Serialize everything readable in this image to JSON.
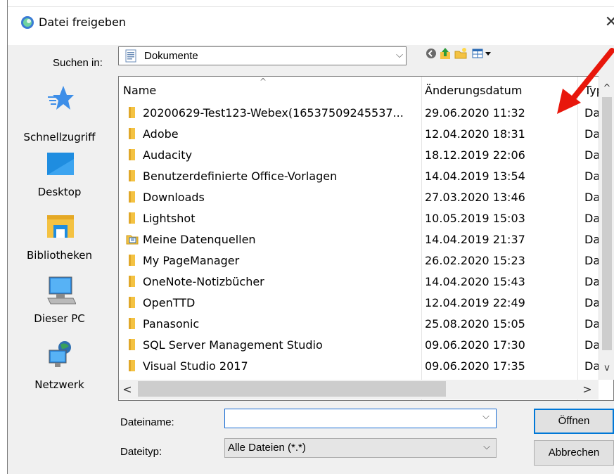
{
  "window": {
    "title": "Datei freigeben",
    "close_glyph": "✕"
  },
  "lookin": {
    "label": "Suchen in:",
    "value": "Dokumente",
    "chevron": "⌵"
  },
  "toolbar": {
    "icons": [
      "back-icon",
      "up-folder-icon",
      "new-folder-icon",
      "view-menu-icon"
    ]
  },
  "places": [
    {
      "label": "Schnellzugriff",
      "icon": "star-icon"
    },
    {
      "label": "Desktop",
      "icon": "desktop-icon"
    },
    {
      "label": "Bibliotheken",
      "icon": "libraries-icon"
    },
    {
      "label": "Dieser PC",
      "icon": "computer-icon"
    },
    {
      "label": "Netzwerk",
      "icon": "network-icon"
    }
  ],
  "columns": {
    "name": "Name",
    "date": "Änderungsdatum",
    "type": "Typ",
    "sort_glyph": "^"
  },
  "files": [
    {
      "name": "20200629-Test123-Webex(16537509245537...",
      "date": "29.06.2020 11:32",
      "type": "Dat",
      "icon": "folder-icon"
    },
    {
      "name": "Adobe",
      "date": "12.04.2020 18:31",
      "type": "Dat",
      "icon": "folder-icon"
    },
    {
      "name": "Audacity",
      "date": "18.12.2019 22:06",
      "type": "Dat",
      "icon": "folder-icon"
    },
    {
      "name": "Benutzerdefinierte Office-Vorlagen",
      "date": "14.04.2019 13:54",
      "type": "Dat",
      "icon": "folder-icon"
    },
    {
      "name": "Downloads",
      "date": "27.03.2020 13:46",
      "type": "Dat",
      "icon": "folder-icon"
    },
    {
      "name": "Lightshot",
      "date": "10.05.2019 15:03",
      "type": "Dat",
      "icon": "folder-icon"
    },
    {
      "name": "Meine Datenquellen",
      "date": "14.04.2019 21:37",
      "type": "Dat",
      "icon": "data-sources-folder-icon"
    },
    {
      "name": "My PageManager",
      "date": "26.02.2020 15:23",
      "type": "Dat",
      "icon": "folder-icon"
    },
    {
      "name": "OneNote-Notizbücher",
      "date": "14.04.2020 15:43",
      "type": "Dat",
      "icon": "folder-icon"
    },
    {
      "name": "OpenTTD",
      "date": "12.04.2019 22:49",
      "type": "Dat",
      "icon": "folder-icon"
    },
    {
      "name": "Panasonic",
      "date": "25.08.2020 15:05",
      "type": "Dat",
      "icon": "folder-icon"
    },
    {
      "name": "SQL Server Management Studio",
      "date": "09.06.2020 17:30",
      "type": "Dat",
      "icon": "folder-icon"
    },
    {
      "name": "Visual Studio 2017",
      "date": "09.06.2020 17:35",
      "type": "Dat",
      "icon": "folder-icon"
    }
  ],
  "scroll": {
    "up": "^",
    "down": "v",
    "left": "<",
    "right": ">"
  },
  "filename": {
    "label": "Dateiname:",
    "value": "",
    "chevron": "⌵"
  },
  "filetype": {
    "label": "Dateityp:",
    "value": "Alle Dateien (*.*)",
    "chevron": "⌵"
  },
  "buttons": {
    "open": "Öffnen",
    "cancel": "Abbrechen"
  },
  "colors": {
    "annotation_arrow": "#e8170c",
    "folder": "#f4c242",
    "accent": "#0078d7"
  }
}
